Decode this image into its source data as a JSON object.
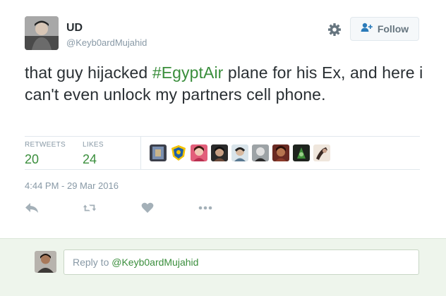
{
  "user": {
    "name": "UD",
    "handle": "@Keyb0ardMujahid"
  },
  "follow_label": "Follow",
  "tweet": {
    "text_before": "that guy hijacked ",
    "hashtag": "#EgyptAir",
    "text_after": " plane for his Ex, and here i can't even unlock my partners cell phone."
  },
  "stats": {
    "retweets_label": "RETWEETS",
    "retweets": "20",
    "likes_label": "LIKES",
    "likes": "24"
  },
  "likers_count": 9,
  "timestamp": "4:44 PM - 29 Mar 2016",
  "actions": [
    "reply-icon",
    "retweet-icon",
    "like-icon",
    "more-icon"
  ],
  "reply": {
    "prefix": "Reply to ",
    "mention": "@Keyb0ardMujahid"
  },
  "colors": {
    "accent": "#3a8e3c",
    "muted": "#8899a6",
    "text": "#292f33",
    "reply_bg": "#eef5ec"
  }
}
